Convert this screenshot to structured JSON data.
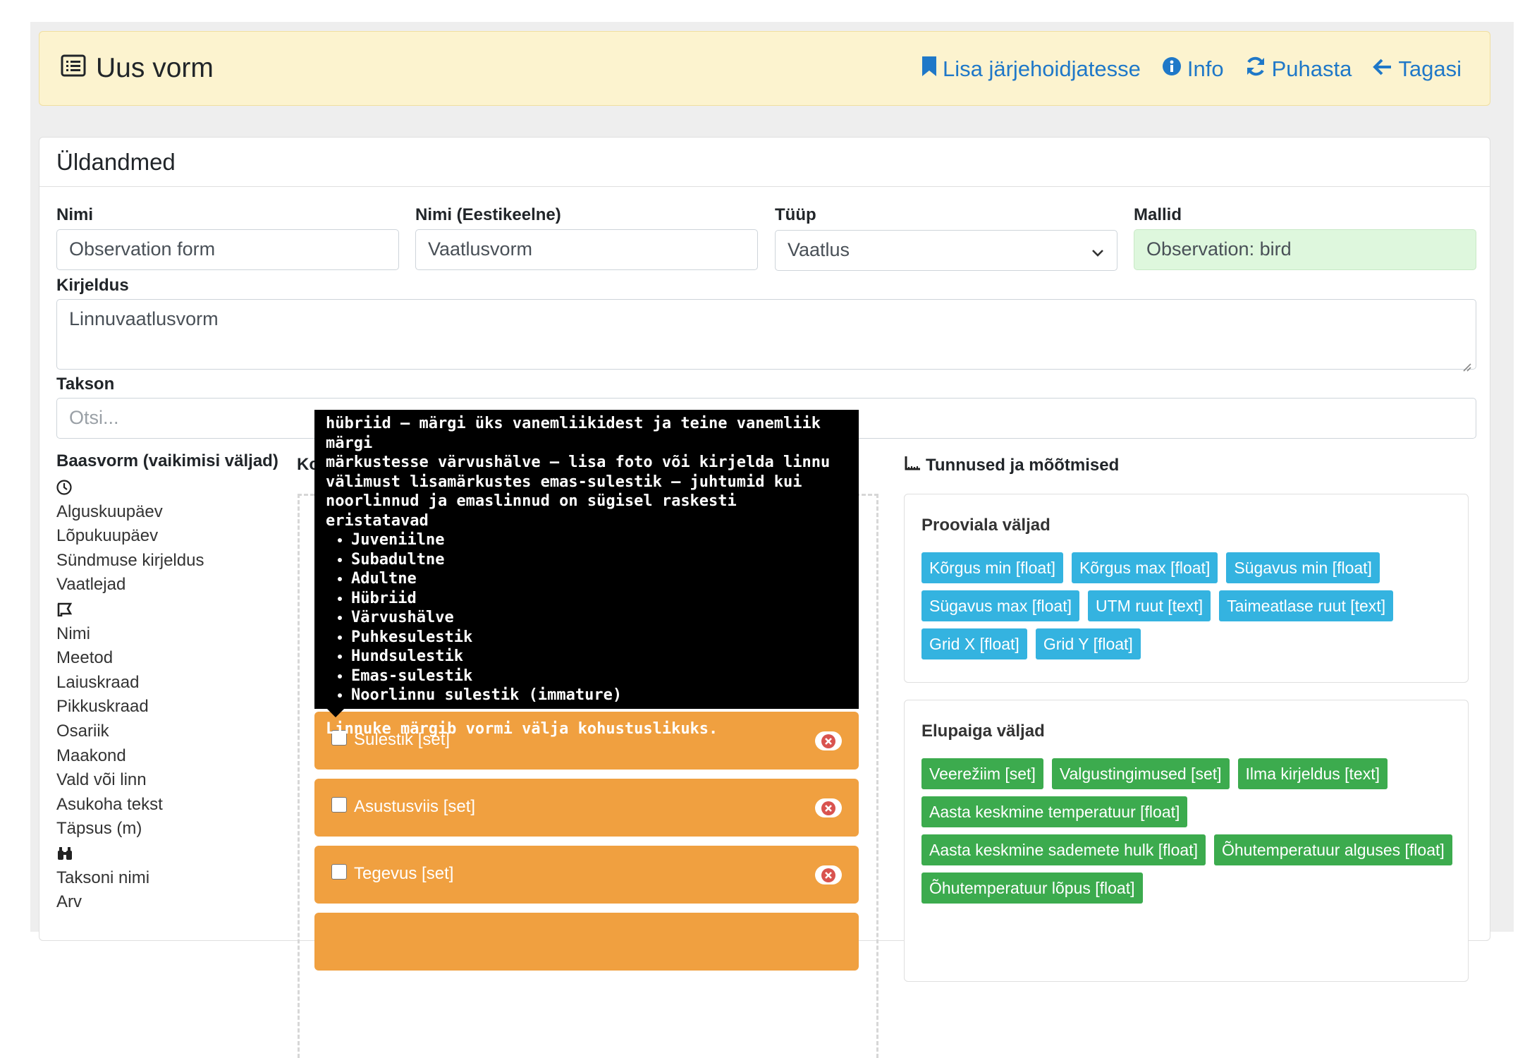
{
  "header": {
    "title": "Uus vorm",
    "actions": [
      {
        "label": "Lisa järjehoidjatesse",
        "icon": "bookmark-icon"
      },
      {
        "label": "Info",
        "icon": "info-icon"
      },
      {
        "label": "Puhasta",
        "icon": "refresh-icon"
      },
      {
        "label": "Tagasi",
        "icon": "arrow-left-icon"
      }
    ]
  },
  "general": {
    "heading": "Üldandmed",
    "name_label": "Nimi",
    "name_value": "Observation form",
    "name_et_label": "Nimi (Eestikeelne)",
    "name_et_value": "Vaatlusvorm",
    "type_label": "Tüüp",
    "type_value": "Vaatlus",
    "templates_label": "Mallid",
    "templates_value": "Observation: bird",
    "description_label": "Kirjeldus",
    "description_value": "Linnuvaatlusvorm",
    "taxon_label": "Takson",
    "taxon_placeholder": "Otsi..."
  },
  "base_form": {
    "heading": "Baasvorm (vaikimisi väljad)",
    "time_fields": [
      "Alguskuupäev",
      "Lõpukuupäev",
      "Sündmuse kirjeldus",
      "Vaatlejad"
    ],
    "location_fields": [
      "Nimi",
      "Meetod",
      "Laiuskraad",
      "Pikkuskraad",
      "Osariik",
      "Maakond",
      "Vald või linn",
      "Asukoha tekst",
      "Täpsus (m)"
    ],
    "taxon_fields": [
      "Taksoni nimi",
      "Arv"
    ]
  },
  "middle": {
    "heading_visible": "Ko",
    "tooltip_lines": [
      "hübriid – märgi üks vanemliikidest ja teine vanemliik märgi",
      "märkustesse värvushälve – lisa foto või kirjelda linnu",
      "välimust lisamärkustes emas-sulestik – juhtumid kui",
      "noorlinnud ja emaslinnud on sügisel raskesti eristatavad"
    ],
    "tooltip_items": [
      "Juveniilne",
      "Subadultne",
      "Adultne",
      "Hübriid",
      "Värvushälve",
      "Puhkesulestik",
      "Hundsulestik",
      "Emas-sulestik",
      "Noorlinnu sulestik (immature)"
    ],
    "tooltip_footer": "Linnuke märgib vormi välja kohustuslikuks.",
    "fields": [
      "Sulestik [set]",
      "Asustusviis [set]",
      "Tegevus [set]"
    ]
  },
  "right": {
    "heading": "Tunnused ja mõõtmised",
    "sample_area": {
      "title": "Prooviala väljad",
      "badges": [
        "Kõrgus min [float]",
        "Kõrgus max [float]",
        "Sügavus min [float]",
        "Sügavus max [float]",
        "UTM ruut [text]",
        "Taimeatlase ruut [text]",
        "Grid X [float]",
        "Grid Y [float]"
      ]
    },
    "habitat": {
      "title": "Elupaiga väljad",
      "badges": [
        "Veerežiim [set]",
        "Valgustingimused [set]",
        "Ilma kirjeldus [text]",
        "Aasta keskmine temperatuur [float]",
        "Aasta keskmine sademete hulk [float]",
        "Õhutemperatuur alguses [float]",
        "Õhutemperatuur lõpus [float]"
      ]
    }
  },
  "colors": {
    "header_bg": "#fcf3cf",
    "link": "#1f78c8",
    "orange_field": "#f0a040",
    "blue_badge": "#34b3e0",
    "green_badge": "#3cab4e",
    "green_input": "#def7dd"
  }
}
